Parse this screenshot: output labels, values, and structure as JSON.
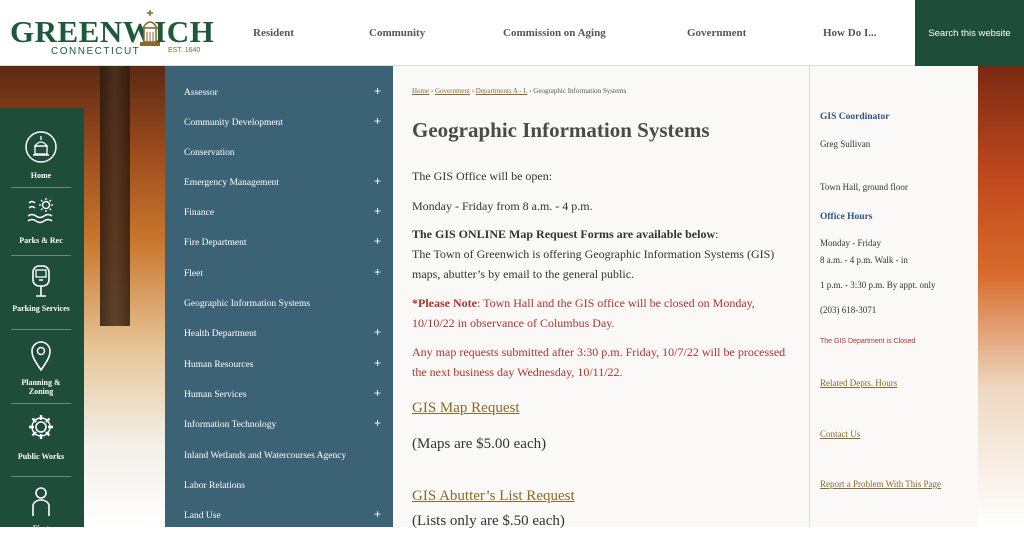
{
  "logo": {
    "word": "GREENWICH",
    "sub": "CONNECTICUT",
    "est": "EST. 1640"
  },
  "nav": [
    "Resident",
    "Community",
    "Commission on Aging",
    "Government",
    "How Do I..."
  ],
  "search_label": "Search this website",
  "rail": [
    {
      "label": "Home",
      "icon": "town-hall-icon"
    },
    {
      "label": "Parks & Rec",
      "icon": "waves-sun-icon"
    },
    {
      "label": "Parking Services",
      "icon": "parking-meter-icon"
    },
    {
      "label": "Planning & Zoning",
      "icon": "map-pin-icon"
    },
    {
      "label": "Public Works",
      "icon": "gear-icon"
    },
    {
      "label": "First",
      "icon": "person-icon"
    }
  ],
  "departments": [
    {
      "label": "Assessor",
      "expand": "+"
    },
    {
      "label": "Community Development",
      "expand": "+"
    },
    {
      "label": "Conservation",
      "expand": ""
    },
    {
      "label": "Emergency Management",
      "expand": "+"
    },
    {
      "label": "Finance",
      "expand": "+"
    },
    {
      "label": "Fire Department",
      "expand": "+"
    },
    {
      "label": "Fleet",
      "expand": "+"
    },
    {
      "label": "Geographic Information Systems",
      "expand": ""
    },
    {
      "label": "Health Department",
      "expand": "+"
    },
    {
      "label": "Human Resources",
      "expand": "+"
    },
    {
      "label": "Human Services",
      "expand": "+"
    },
    {
      "label": "Information Technology",
      "expand": "+"
    },
    {
      "label": "Inland Wetlands and Watercourses Agency",
      "expand": ""
    },
    {
      "label": "Labor Relations",
      "expand": ""
    },
    {
      "label": "Land Use",
      "expand": "+"
    }
  ],
  "breadcrumb": {
    "home": "Home",
    "sep": " › ",
    "government": "Government",
    "depts": "Departments A - L",
    "current": "Geographic Information Systems"
  },
  "main": {
    "title": "Geographic Information Systems",
    "open_intro": "The GIS Office will be open:",
    "hours": "Monday - Friday from 8 a.m. - 4 p.m.",
    "forms_heading": "The GIS ONLINE Map Request Forms are available below",
    "forms_colon": ":",
    "forms_text": "The Town of Greenwich is offering Geographic Information Systems (GIS) maps, abutter’s by email to the general public.",
    "note_label": "*Please Note",
    "note_text": ":  Town Hall and the GIS office will be closed on Monday, 10/10/22 in observance of Columbus Day.",
    "late_text": "Any map requests submitted after 3:30 p.m. Friday, 10/7/22 will be processed the next business day Wednesday, 10/11/22.",
    "map_link": "GIS Map Request",
    "map_price": "(Maps are $5.00 each)",
    "abutter_link": "GIS Abutter’s List Request",
    "abutter_price": "(Lists only are $.50 each)"
  },
  "sidebar": {
    "coord_heading": "GIS Coordinator",
    "coord_name": "Greg Sullivan",
    "location": "Town Hall, ground floor",
    "hours_heading": "Office Hours",
    "days": "Monday - Friday",
    "hours1": "8 a.m. - 4 p.m. Walk - in",
    "hours2": "1 p.m. - 3:30 p.m. By appt. only",
    "phone": "(203) 618-3071",
    "closed_notice": "The GIS Department is Closed",
    "related_link": "Related Depts. Hours",
    "contact_link": "Contact Us",
    "report_link": "Report a Problem With This Page"
  },
  "colors": {
    "brand_green": "#1e4d3a",
    "dept_blue": "#3c6275",
    "link_gold": "#8a6a2a",
    "alert_red": "#b0322e",
    "side_heading": "#2c5580"
  }
}
